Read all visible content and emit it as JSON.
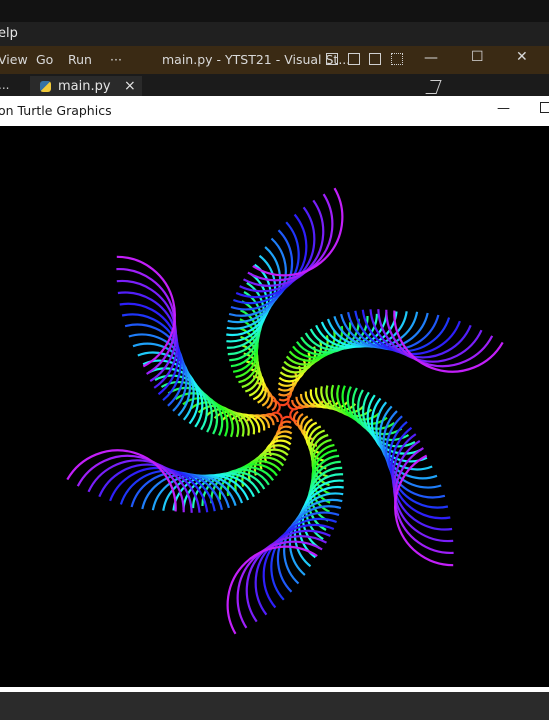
{
  "vscode": {
    "menu": [
      "elp",
      "View",
      "Go",
      "Run",
      "···"
    ],
    "window_title": "main.py - YTST21 - Visual St...",
    "tab_label": "main.py",
    "tab_close": "×",
    "left_truncated": "..."
  },
  "turtle": {
    "title": "on Turtle Graphics",
    "minimize": "—"
  },
  "colors": {
    "canvas": "#000000",
    "vscode_title": "#3a2a14",
    "vscode_menu": "#202020"
  }
}
